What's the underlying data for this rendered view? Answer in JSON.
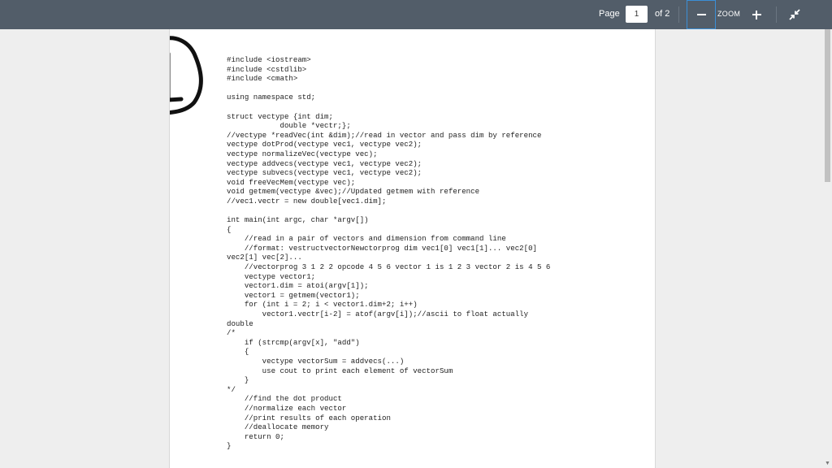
{
  "toolbar": {
    "page_label": "Page",
    "page_value": "1",
    "page_of": "of 2",
    "zoom_label": "ZOOM",
    "zoom_out_icon": "minus-icon",
    "zoom_in_icon": "plus-icon",
    "collapse_icon": "collapse-arrows-icon"
  },
  "annotation": {
    "label": "1"
  },
  "document": {
    "code_lines": [
      "#include <iostream>",
      "#include <cstdlib>",
      "#include <cmath>",
      "",
      "using namespace std;",
      "",
      "struct vectype {int dim;",
      "            double *vectr;};",
      "//vectype *readVec(int &dim);//read in vector and pass dim by reference",
      "vectype dotProd(vectype vec1, vectype vec2);",
      "vectype normalizeVec(vectype vec);",
      "vectype addvecs(vectype vec1, vectype vec2);",
      "vectype subvecs(vectype vec1, vectype vec2);",
      "void freeVecMem(vectype vec);",
      "void getmem(vectype &vec);//Updated getmem with reference",
      "//vec1.vectr = new double[vec1.dim];",
      "",
      "int main(int argc, char *argv[])",
      "{",
      "    //read in a pair of vectors and dimension from command line",
      "    //format: vestructvectorNewctorprog dim vec1[0] vec1[1]... vec2[0]",
      "vec2[1] vec[2]...",
      "    //vectorprog 3 1 2 2 opcode 4 5 6 vector 1 is 1 2 3 vector 2 is 4 5 6",
      "    vectype vector1;",
      "    vector1.dim = atoi(argv[1]);",
      "    vector1 = getmem(vector1);",
      "    for (int i = 2; i < vector1.dim+2; i++)",
      "        vector1.vectr[i-2] = atof(argv[i]);//ascii to float actually",
      "double",
      "/*",
      "    if (strcmp(argv[x], \"add\")",
      "    {",
      "        vectype vectorSum = addvecs(...)",
      "        use cout to print each element of vectorSum",
      "    }",
      "*/",
      "    //find the dot product",
      "    //normalize each vector",
      "    //print results of each operation",
      "    //deallocate memory",
      "    return 0;",
      "}"
    ]
  }
}
